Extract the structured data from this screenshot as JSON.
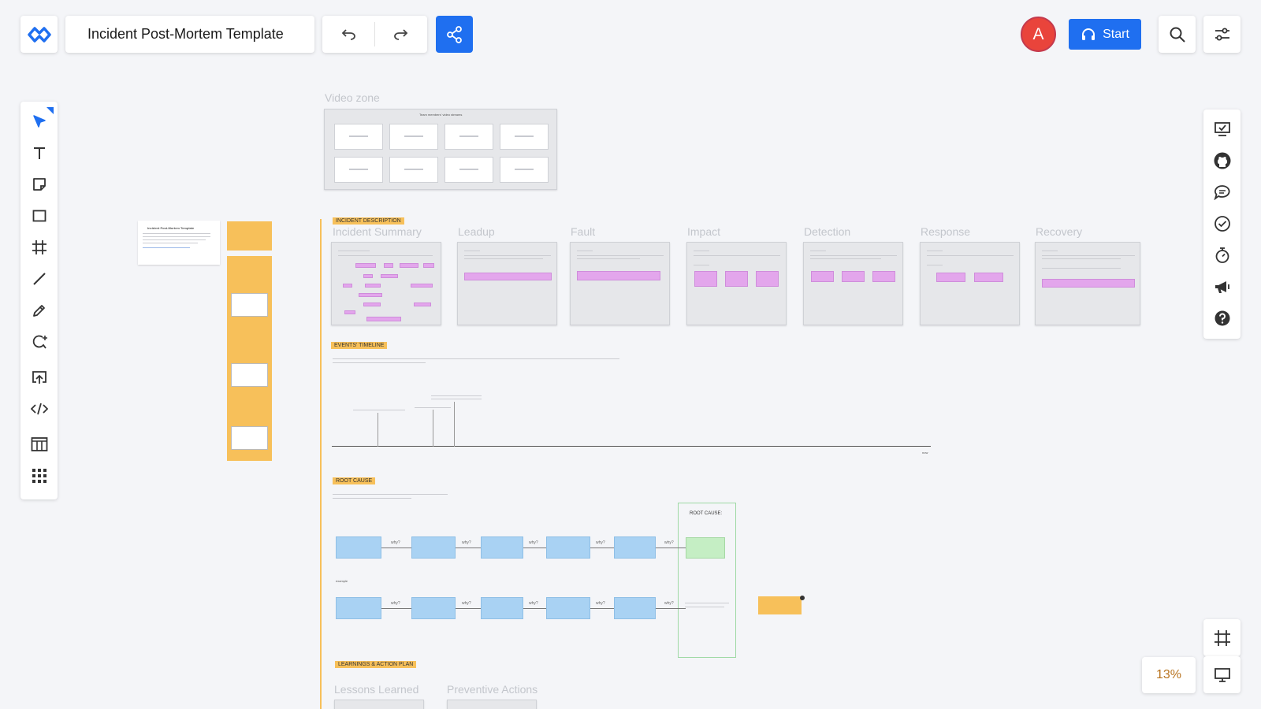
{
  "header": {
    "title": "Incident Post-Mortem Template",
    "start_label": "Start",
    "avatar_initial": "A"
  },
  "toolbar_left": {
    "tools": [
      "select-icon",
      "text-icon",
      "sticky-note-icon",
      "rectangle-icon",
      "frame-icon",
      "line-icon",
      "pen-icon",
      "lasso-icon",
      "upload-icon",
      "embed-icon",
      "table-icon",
      "apps-icon"
    ]
  },
  "toolbar_right": {
    "tools": [
      "checklist-icon",
      "github-icon",
      "comment-icon",
      "check-circle-icon",
      "timer-icon",
      "announce-icon",
      "help-icon"
    ]
  },
  "zoom": {
    "label": "13%"
  },
  "colors": {
    "accent": "#1f6ff0",
    "avatar": "#e9443b",
    "tag": "#f7c05a",
    "zoom_text": "#b8731f"
  },
  "canvas": {
    "video_zone": {
      "label": "Video zone",
      "header": "Team members' video streams",
      "tiles": 8
    },
    "sections": {
      "incident_description": "INCIDENT DESCRIPTION",
      "events_timeline": "EVENTS' TIMELINE",
      "root_cause": "ROOT CAUSE",
      "learnings": "LEARNINGS & ACTION PLAN"
    },
    "phase_labels": [
      "Incident Summary",
      "Leadup",
      "Fault",
      "Impact",
      "Detection",
      "Response",
      "Recovery"
    ],
    "learning_labels": [
      "Lessons Learned",
      "Preventive Actions"
    ],
    "root_cause_box": "ROOT CAUSE:",
    "why": "why?",
    "example_label": "example",
    "timeline_end": "now",
    "left_template_title": "Incident Post-Mortem Template"
  }
}
